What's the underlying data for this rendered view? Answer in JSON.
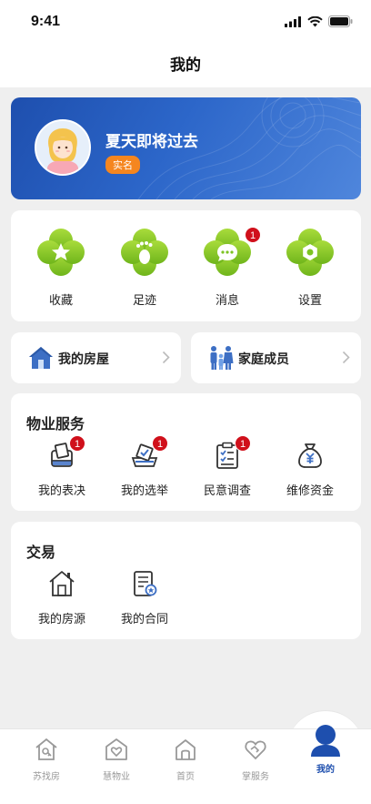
{
  "status_bar": {
    "time": "9:41"
  },
  "nav": {
    "title": "我的"
  },
  "profile": {
    "username": "夏天即将过去",
    "badge": "实名"
  },
  "quick_actions": [
    {
      "label": "收藏",
      "icon": "star-icon"
    },
    {
      "label": "足迹",
      "icon": "footprint-icon"
    },
    {
      "label": "消息",
      "icon": "message-icon",
      "badge": "1"
    },
    {
      "label": "设置",
      "icon": "settings-icon"
    }
  ],
  "shortcuts": {
    "my_house": "我的房屋",
    "family": "家庭成员"
  },
  "property_services": {
    "title": "物业服务",
    "items": [
      {
        "label": "我的表决",
        "badge": "1"
      },
      {
        "label": "我的选举",
        "badge": "1"
      },
      {
        "label": "民意调查",
        "badge": "1"
      },
      {
        "label": "维修资金"
      }
    ]
  },
  "trade": {
    "title": "交易",
    "items": [
      {
        "label": "我的房源"
      },
      {
        "label": "我的合同"
      }
    ]
  },
  "tabs": [
    {
      "label": "苏找房"
    },
    {
      "label": "慧物业"
    },
    {
      "label": "首页"
    },
    {
      "label": "掌服务"
    },
    {
      "label": "我的",
      "active": true
    }
  ],
  "colors": {
    "primary": "#1e4fae",
    "accent_green": "#7cc422",
    "badge_red": "#d0101b",
    "badge_orange": "#f5861f"
  }
}
